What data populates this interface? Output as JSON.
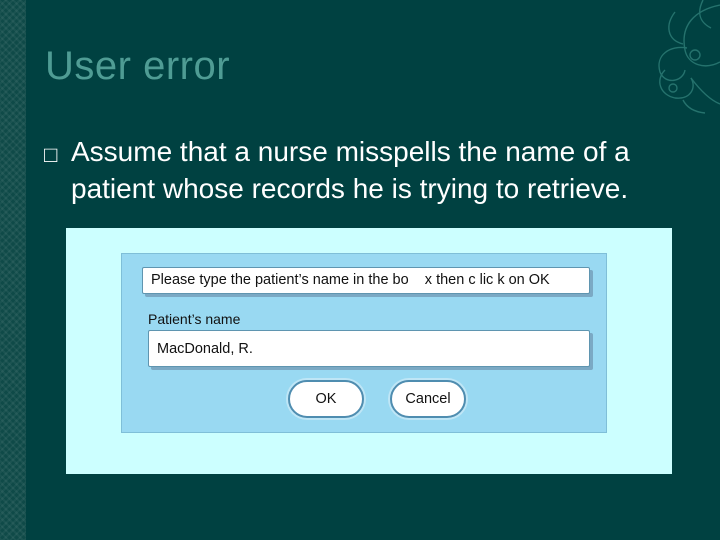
{
  "slide": {
    "title": "User error",
    "bullet_symbol": "□",
    "body": "Assume that a nurse misspells the name of a patient whose records he is trying to retrieve."
  },
  "dialog": {
    "instruction": "Please type the patient’s name in the bo    x then c lic k on OK",
    "field_label": "Patient’s name",
    "field_value": "MacDonald, R.",
    "ok_label": "OK",
    "cancel_label": "Cancel"
  },
  "colors": {
    "background": "#004141",
    "title": "#4f9c94",
    "panel": "#ccffff",
    "dialog": "#99d9f2"
  }
}
